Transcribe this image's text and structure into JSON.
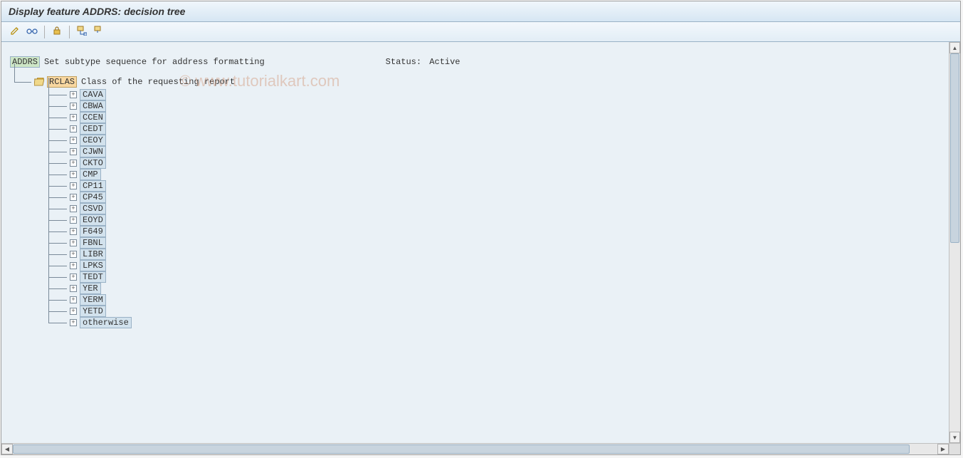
{
  "title": "Display feature ADDRS: decision tree",
  "watermark": "© www.tutorialkart.com",
  "root": {
    "code": "ADDRS",
    "description": "Set subtype sequence for address formatting",
    "status_label": "Status:",
    "status_value": "Active"
  },
  "rclas": {
    "code": "RCLAS",
    "description": "Class of the requesting report"
  },
  "nodes": [
    "CAVA",
    "CBWA",
    "CCEN",
    "CEDT",
    "CEOY",
    "CJWN",
    "CKTO",
    "CMP",
    "CP11",
    "CP45",
    "CSVD",
    "EOYD",
    "F649",
    "FBNL",
    "LIBR",
    "LPKS",
    "TEDT",
    "YER",
    "YERM",
    "YETD",
    "otherwise"
  ],
  "toolbar_icons": {
    "edit": "edit-icon",
    "check": "check-icon",
    "display_object": "display-object-icon",
    "expand": "expand-icon",
    "collapse": "collapse-icon"
  }
}
